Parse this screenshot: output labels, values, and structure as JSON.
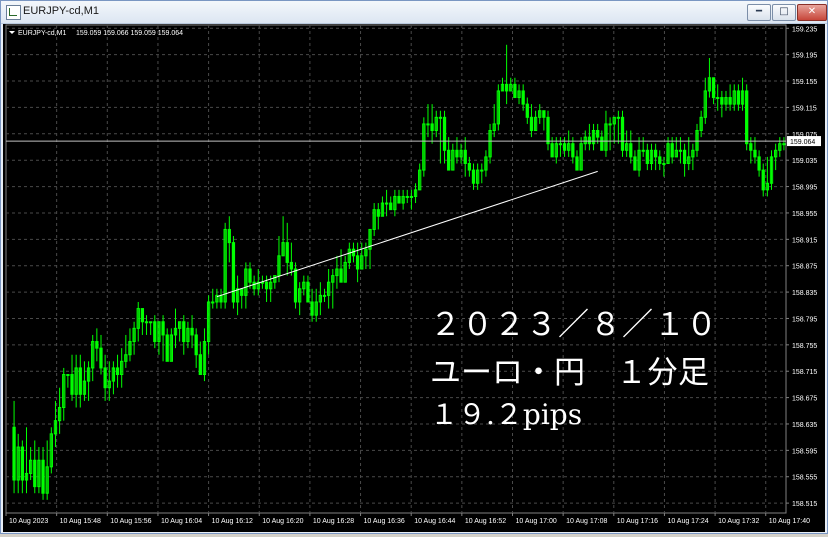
{
  "window": {
    "title": "EURJPY-cd,M1"
  },
  "chart_header": {
    "symbol_label": "EURJPY-cd,M1",
    "ohlc": "159.059 159.066 159.059 159.064"
  },
  "overlay": {
    "line1": "２０２３／８／１０",
    "line2": "ユーロ・円　１分足",
    "line3": "１９.２pips"
  },
  "colors": {
    "background": "#000000",
    "grid": "#4a4a4a",
    "candle": "#00ff00",
    "axis_text": "#ffffff",
    "trendline": "#ffffff",
    "price_line": "#c0c0c0"
  },
  "chart_data": {
    "type": "candlestick",
    "symbol": "EURJPY-cd",
    "timeframe": "M1",
    "ylim": [
      158.5,
      159.24
    ],
    "y_ticks": [
      "159.235",
      "159.195",
      "159.155",
      "159.115",
      "159.075",
      "159.035",
      "158.995",
      "158.955",
      "158.915",
      "158.875",
      "158.835",
      "158.795",
      "158.755",
      "158.715",
      "158.675",
      "158.635",
      "158.595",
      "158.555",
      "158.515"
    ],
    "x_ticks": [
      "10 Aug 2023",
      "10 Aug 15:48",
      "10 Aug 15:56",
      "10 Aug 16:04",
      "10 Aug 16:12",
      "10 Aug 16:20",
      "10 Aug 16:28",
      "10 Aug 16:36",
      "10 Aug 16:44",
      "10 Aug 16:52",
      "10 Aug 17:00",
      "10 Aug 17:08",
      "10 Aug 17:16",
      "10 Aug 17:24",
      "10 Aug 17:32",
      "10 Aug 17:40"
    ],
    "current_price": "159.064",
    "trendline": {
      "start": {
        "bar": 49,
        "price": 158.828
      },
      "end": {
        "bar": 141,
        "price": 159.018
      }
    },
    "candles": [
      [
        158.63,
        158.55,
        158.67,
        158.53
      ],
      [
        158.55,
        158.6,
        158.62,
        158.53
      ],
      [
        158.6,
        158.55,
        158.61,
        158.53
      ],
      [
        158.55,
        158.56,
        158.63,
        158.53
      ],
      [
        158.56,
        158.58,
        158.6,
        158.55
      ],
      [
        158.58,
        158.54,
        158.61,
        158.53
      ],
      [
        158.54,
        158.58,
        158.6,
        158.53
      ],
      [
        158.58,
        158.53,
        158.6,
        158.52
      ],
      [
        158.53,
        158.57,
        158.61,
        158.52
      ],
      [
        158.57,
        158.62,
        158.63,
        158.56
      ],
      [
        158.62,
        158.64,
        158.67,
        158.6
      ],
      [
        158.64,
        158.66,
        158.69,
        158.62
      ],
      [
        158.66,
        158.71,
        158.72,
        158.64
      ],
      [
        158.71,
        158.71,
        158.71,
        158.69
      ],
      [
        158.71,
        158.68,
        158.74,
        158.67
      ],
      [
        158.68,
        158.72,
        158.74,
        158.66
      ],
      [
        158.72,
        158.68,
        158.74,
        158.66
      ],
      [
        158.68,
        158.7,
        158.73,
        158.67
      ],
      [
        158.7,
        158.72,
        158.73,
        158.67
      ],
      [
        158.72,
        158.76,
        158.77,
        158.7
      ],
      [
        158.76,
        158.75,
        158.78,
        158.73
      ],
      [
        158.75,
        158.72,
        158.77,
        158.71
      ],
      [
        158.72,
        158.69,
        158.74,
        158.67
      ],
      [
        158.69,
        158.7,
        158.73,
        158.67
      ],
      [
        158.7,
        158.72,
        158.73,
        158.68
      ],
      [
        158.72,
        158.71,
        158.74,
        158.69
      ],
      [
        158.71,
        158.73,
        158.75,
        158.69
      ],
      [
        158.73,
        158.74,
        158.77,
        158.72
      ],
      [
        158.74,
        158.76,
        158.78,
        158.73
      ],
      [
        158.76,
        158.78,
        158.79,
        158.74
      ],
      [
        158.78,
        158.81,
        158.82,
        158.76
      ],
      [
        158.81,
        158.79,
        158.81,
        158.77
      ],
      [
        158.79,
        158.79,
        158.8,
        158.77
      ],
      [
        158.79,
        158.79,
        158.79,
        158.77
      ],
      [
        158.79,
        158.76,
        158.8,
        158.75
      ],
      [
        158.76,
        158.79,
        158.79,
        158.74
      ],
      [
        158.79,
        158.77,
        158.8,
        158.73
      ],
      [
        158.77,
        158.73,
        158.78,
        158.73
      ],
      [
        158.73,
        158.77,
        158.78,
        158.73
      ],
      [
        158.77,
        158.78,
        158.81,
        158.75
      ],
      [
        158.78,
        158.79,
        158.79,
        158.76
      ],
      [
        158.79,
        158.76,
        158.8,
        158.74
      ],
      [
        158.76,
        158.78,
        158.79,
        158.75
      ],
      [
        158.78,
        158.77,
        158.8,
        158.75
      ],
      [
        158.77,
        158.74,
        158.78,
        158.72
      ],
      [
        158.74,
        158.71,
        158.76,
        158.71
      ],
      [
        158.71,
        158.76,
        158.78,
        158.7
      ],
      [
        158.76,
        158.82,
        158.83,
        158.74
      ],
      [
        158.82,
        158.82,
        158.84,
        158.81
      ],
      [
        158.82,
        158.83,
        158.84,
        158.81
      ],
      [
        158.83,
        158.82,
        158.84,
        158.81
      ],
      [
        158.82,
        158.93,
        158.94,
        158.81
      ],
      [
        158.93,
        158.91,
        158.95,
        158.88
      ],
      [
        158.91,
        158.82,
        158.92,
        158.81
      ],
      [
        158.82,
        158.84,
        158.86,
        158.8
      ],
      [
        158.84,
        158.83,
        158.84,
        158.81
      ],
      [
        158.83,
        158.87,
        158.88,
        158.81
      ],
      [
        158.87,
        158.85,
        158.88,
        158.84
      ],
      [
        158.85,
        158.84,
        158.86,
        158.83
      ],
      [
        158.84,
        158.85,
        158.87,
        158.83
      ],
      [
        158.85,
        158.85,
        158.86,
        158.84
      ],
      [
        158.85,
        158.84,
        158.86,
        158.82
      ],
      [
        158.84,
        158.85,
        158.86,
        158.82
      ],
      [
        158.85,
        158.86,
        158.86,
        158.84
      ],
      [
        158.86,
        158.89,
        158.92,
        158.85
      ],
      [
        158.89,
        158.91,
        158.95,
        158.89
      ],
      [
        158.91,
        158.88,
        158.94,
        158.86
      ],
      [
        158.88,
        158.87,
        158.91,
        158.86
      ],
      [
        158.87,
        158.82,
        158.88,
        158.81
      ],
      [
        158.82,
        158.84,
        158.85,
        158.8
      ],
      [
        158.84,
        158.85,
        158.86,
        158.83
      ],
      [
        158.85,
        158.82,
        158.86,
        158.82
      ],
      [
        158.82,
        158.8,
        158.84,
        158.79
      ],
      [
        158.8,
        158.82,
        158.84,
        158.79
      ],
      [
        158.82,
        158.83,
        158.85,
        158.8
      ],
      [
        158.83,
        158.83,
        158.84,
        158.82
      ],
      [
        158.83,
        158.85,
        158.87,
        158.81
      ],
      [
        158.85,
        158.86,
        158.87,
        158.81
      ],
      [
        158.86,
        158.87,
        158.89,
        158.84
      ],
      [
        158.87,
        158.85,
        158.9,
        158.85
      ],
      [
        158.85,
        158.88,
        158.89,
        158.85
      ],
      [
        158.88,
        158.9,
        158.91,
        158.87
      ],
      [
        158.9,
        158.89,
        158.91,
        158.88
      ],
      [
        158.89,
        158.87,
        158.91,
        158.85
      ],
      [
        158.87,
        158.89,
        158.91,
        158.87
      ],
      [
        158.89,
        158.9,
        158.91,
        158.87
      ],
      [
        158.9,
        158.93,
        158.93,
        158.87
      ],
      [
        158.93,
        158.96,
        158.97,
        158.92
      ],
      [
        158.96,
        158.95,
        158.97,
        158.93
      ],
      [
        158.95,
        158.97,
        158.98,
        158.95
      ],
      [
        158.97,
        158.97,
        158.99,
        158.95
      ],
      [
        158.97,
        158.96,
        158.98,
        158.96
      ],
      [
        158.96,
        158.98,
        158.99,
        158.95
      ],
      [
        158.98,
        158.97,
        158.99,
        158.97
      ],
      [
        158.97,
        158.98,
        158.99,
        158.96
      ],
      [
        158.98,
        158.98,
        158.99,
        158.97
      ],
      [
        158.98,
        158.98,
        158.99,
        158.96
      ],
      [
        158.98,
        158.99,
        159.0,
        158.97
      ],
      [
        158.99,
        159.02,
        159.03,
        158.99
      ],
      [
        159.02,
        159.09,
        159.1,
        159.01
      ],
      [
        159.09,
        159.09,
        159.12,
        159.07
      ],
      [
        159.09,
        159.08,
        159.12,
        159.06
      ],
      [
        159.08,
        159.1,
        159.11,
        159.07
      ],
      [
        159.1,
        159.1,
        159.11,
        159.03
      ],
      [
        159.1,
        159.05,
        159.11,
        159.03
      ],
      [
        159.05,
        159.02,
        159.07,
        159.02
      ],
      [
        159.02,
        159.05,
        159.06,
        159.02
      ],
      [
        159.05,
        159.04,
        159.07,
        159.03
      ],
      [
        159.04,
        159.05,
        159.06,
        159.03
      ],
      [
        159.05,
        159.03,
        159.07,
        159.01
      ],
      [
        159.03,
        159.02,
        159.04,
        159.01
      ],
      [
        159.02,
        159.0,
        159.03,
        158.99
      ],
      [
        159.0,
        159.02,
        159.03,
        158.99
      ],
      [
        159.02,
        159.02,
        159.03,
        159.0
      ],
      [
        159.02,
        159.04,
        159.05,
        159.01
      ],
      [
        159.04,
        159.08,
        159.09,
        159.03
      ],
      [
        159.08,
        159.09,
        159.12,
        159.07
      ],
      [
        159.09,
        159.14,
        159.15,
        159.08
      ],
      [
        159.14,
        159.15,
        159.16,
        159.14
      ],
      [
        159.15,
        159.14,
        159.21,
        159.12
      ],
      [
        159.14,
        159.15,
        159.16,
        159.14
      ],
      [
        159.15,
        159.13,
        159.16,
        159.13
      ],
      [
        159.13,
        159.14,
        159.15,
        159.12
      ],
      [
        159.14,
        159.12,
        159.15,
        159.11
      ],
      [
        159.12,
        159.1,
        159.13,
        159.09
      ],
      [
        159.1,
        159.08,
        159.12,
        159.07
      ],
      [
        159.08,
        159.1,
        159.11,
        159.08
      ],
      [
        159.1,
        159.11,
        159.12,
        159.09
      ],
      [
        159.11,
        159.1,
        159.11,
        159.08
      ],
      [
        159.1,
        159.06,
        159.11,
        159.05
      ],
      [
        159.06,
        159.04,
        159.07,
        159.04
      ],
      [
        159.04,
        159.06,
        159.07,
        159.03
      ],
      [
        159.06,
        159.06,
        159.07,
        159.04
      ],
      [
        159.06,
        159.05,
        159.07,
        159.04
      ],
      [
        159.05,
        159.06,
        159.08,
        159.04
      ],
      [
        159.06,
        159.04,
        159.07,
        159.03
      ],
      [
        159.04,
        159.02,
        159.05,
        159.02
      ],
      [
        159.02,
        159.06,
        159.07,
        159.02
      ],
      [
        159.06,
        159.07,
        159.08,
        159.05
      ],
      [
        159.07,
        159.06,
        159.09,
        159.05
      ],
      [
        159.06,
        159.08,
        159.09,
        159.05
      ],
      [
        159.08,
        159.07,
        159.09,
        159.06
      ],
      [
        159.07,
        159.05,
        159.08,
        159.05
      ],
      [
        159.05,
        159.09,
        159.11,
        159.04
      ],
      [
        159.09,
        159.09,
        159.1,
        159.05
      ],
      [
        159.09,
        159.1,
        159.1,
        159.06
      ],
      [
        159.1,
        159.1,
        159.11,
        159.06
      ],
      [
        159.1,
        159.05,
        159.11,
        159.04
      ],
      [
        159.05,
        159.06,
        159.08,
        159.04
      ],
      [
        159.06,
        159.04,
        159.08,
        159.03
      ],
      [
        159.04,
        159.02,
        159.05,
        159.02
      ],
      [
        159.02,
        159.05,
        159.07,
        159.01
      ],
      [
        159.05,
        159.05,
        159.07,
        159.04
      ],
      [
        159.05,
        159.03,
        159.06,
        159.02
      ],
      [
        159.03,
        159.05,
        159.06,
        159.02
      ],
      [
        159.05,
        159.04,
        159.06,
        159.02
      ],
      [
        159.04,
        159.03,
        159.05,
        159.02
      ],
      [
        159.03,
        159.03,
        159.04,
        159.01
      ],
      [
        159.03,
        159.06,
        159.07,
        159.03
      ],
      [
        159.06,
        159.04,
        159.07,
        159.03
      ],
      [
        159.04,
        159.05,
        159.07,
        159.04
      ],
      [
        159.05,
        159.05,
        159.07,
        159.03
      ],
      [
        159.05,
        159.03,
        159.06,
        159.01
      ],
      [
        159.03,
        159.04,
        159.07,
        159.02
      ],
      [
        159.04,
        159.05,
        159.06,
        159.02
      ],
      [
        159.05,
        159.08,
        159.09,
        159.04
      ],
      [
        159.08,
        159.1,
        159.11,
        159.07
      ],
      [
        159.1,
        159.14,
        159.16,
        159.09
      ],
      [
        159.14,
        159.16,
        159.19,
        159.13
      ],
      [
        159.16,
        159.13,
        159.16,
        159.12
      ],
      [
        159.13,
        159.13,
        159.15,
        159.11
      ],
      [
        159.13,
        159.12,
        159.14,
        159.1
      ],
      [
        159.12,
        159.13,
        159.14,
        159.11
      ],
      [
        159.13,
        159.12,
        159.15,
        159.11
      ],
      [
        159.12,
        159.14,
        159.15,
        159.11
      ],
      [
        159.14,
        159.12,
        159.15,
        159.11
      ],
      [
        159.12,
        159.14,
        159.16,
        159.11
      ],
      [
        159.14,
        159.06,
        159.15,
        159.05
      ],
      [
        159.06,
        159.05,
        159.07,
        159.03
      ],
      [
        159.05,
        159.04,
        159.07,
        159.03
      ],
      [
        159.04,
        159.02,
        159.05,
        159.01
      ],
      [
        159.02,
        158.99,
        159.03,
        158.98
      ],
      [
        158.99,
        159.0,
        159.04,
        158.98
      ],
      [
        159.0,
        159.04,
        159.05,
        158.99
      ],
      [
        159.04,
        159.05,
        159.06,
        159.02
      ],
      [
        159.05,
        159.06,
        159.07,
        159.04
      ],
      [
        159.06,
        159.06,
        159.07,
        159.05
      ]
    ]
  }
}
